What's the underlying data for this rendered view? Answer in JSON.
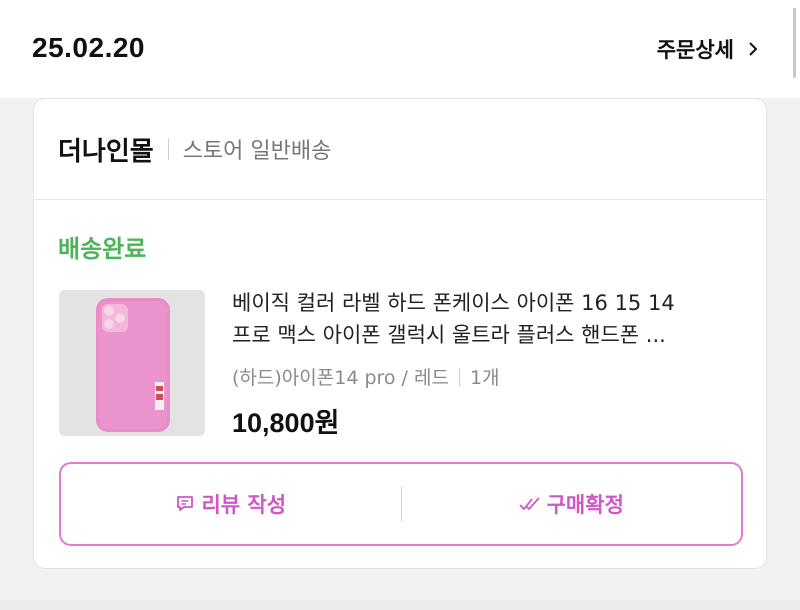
{
  "order": {
    "date": "25.02.20",
    "detail_label": "주문상세"
  },
  "store": {
    "name": "더나인몰",
    "type": "스토어 일반배송"
  },
  "status": "배송완료",
  "product": {
    "name_line1": "베이직 컬러 라벨 하드 폰케이스 아이폰 16 15 14",
    "name_line2": "프로 맥스 아이폰 갤럭시 울트라 플러스 핸드폰 ...",
    "option": "(하드)아이폰14 pro / 레드",
    "quantity": "1개",
    "price": "10,800원",
    "image_icon": "pink-phone-case-image"
  },
  "actions": {
    "review_label": "리뷰 작성",
    "confirm_label": "구매확정"
  },
  "colors": {
    "accent": "#d056c8",
    "status": "#4cb35a"
  }
}
